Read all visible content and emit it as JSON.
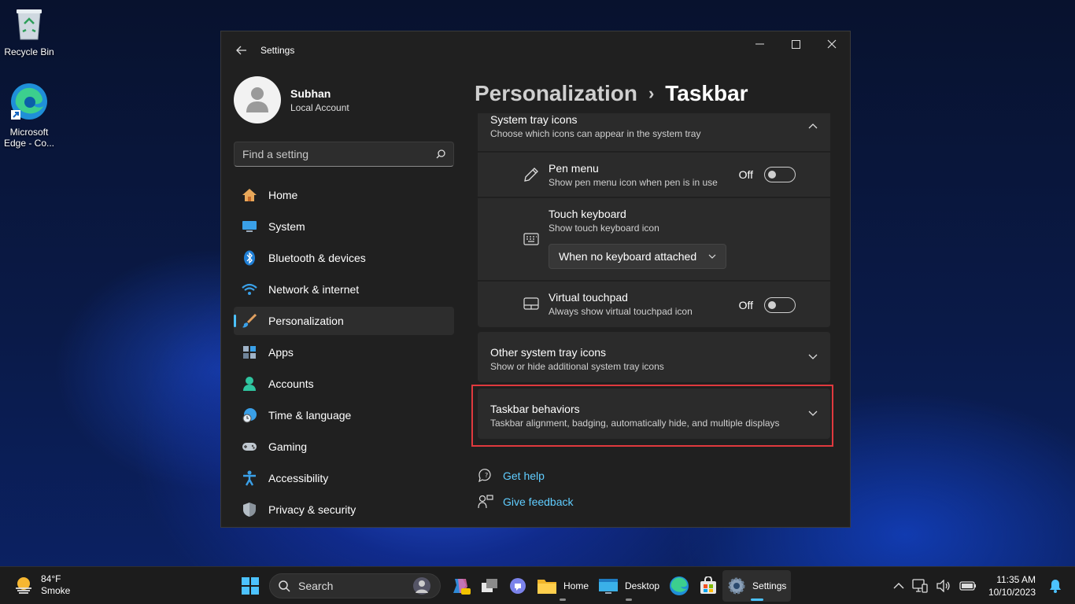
{
  "desktop": {
    "icons": [
      {
        "label": "Recycle Bin"
      },
      {
        "label": "Microsoft Edge - Co..."
      }
    ]
  },
  "window": {
    "title": "Settings",
    "controls": {
      "minimize": "—",
      "maximize": "☐",
      "close": "✕"
    }
  },
  "profile": {
    "name": "Subhan",
    "account": "Local Account"
  },
  "search": {
    "placeholder": "Find a setting"
  },
  "sidebar": {
    "items": [
      {
        "label": "Home",
        "icon": "home-icon"
      },
      {
        "label": "System",
        "icon": "system-icon"
      },
      {
        "label": "Bluetooth & devices",
        "icon": "bluetooth-icon"
      },
      {
        "label": "Network & internet",
        "icon": "wifi-icon"
      },
      {
        "label": "Personalization",
        "icon": "brush-icon",
        "active": true
      },
      {
        "label": "Apps",
        "icon": "apps-icon"
      },
      {
        "label": "Accounts",
        "icon": "accounts-icon"
      },
      {
        "label": "Time & language",
        "icon": "time-language-icon"
      },
      {
        "label": "Gaming",
        "icon": "gamepad-icon"
      },
      {
        "label": "Accessibility",
        "icon": "accessibility-icon"
      },
      {
        "label": "Privacy & security",
        "icon": "shield-icon"
      }
    ]
  },
  "breadcrumb": {
    "parent": "Personalization",
    "separator": "›",
    "current": "Taskbar"
  },
  "tray_section": {
    "title": "System tray icons",
    "subtitle": "Choose which icons can appear in the system tray",
    "pen": {
      "title": "Pen menu",
      "subtitle": "Show pen menu icon when pen is in use",
      "state": "Off"
    },
    "touch_keyboard": {
      "title": "Touch keyboard",
      "subtitle": "Show touch keyboard icon",
      "dropdown_value": "When no keyboard attached"
    },
    "touchpad": {
      "title": "Virtual touchpad",
      "subtitle": "Always show virtual touchpad icon",
      "state": "Off"
    }
  },
  "other_tray": {
    "title": "Other system tray icons",
    "subtitle": "Show or hide additional system tray icons"
  },
  "behaviors": {
    "title": "Taskbar behaviors",
    "subtitle": "Taskbar alignment, badging, automatically hide, and multiple displays"
  },
  "links": {
    "help": "Get help",
    "feedback": "Give feedback"
  },
  "taskbar": {
    "weather_temp": "84°F",
    "weather_desc": "Smoke",
    "search_label": "Search",
    "apps": [
      {
        "label": "Home"
      },
      {
        "label": "Desktop"
      },
      {
        "label": "Settings"
      }
    ],
    "time": "11:35 AM",
    "date": "10/10/2023"
  },
  "colors": {
    "accent": "#4cc2ff",
    "link": "#60cdff",
    "highlight": "#e0393e"
  }
}
